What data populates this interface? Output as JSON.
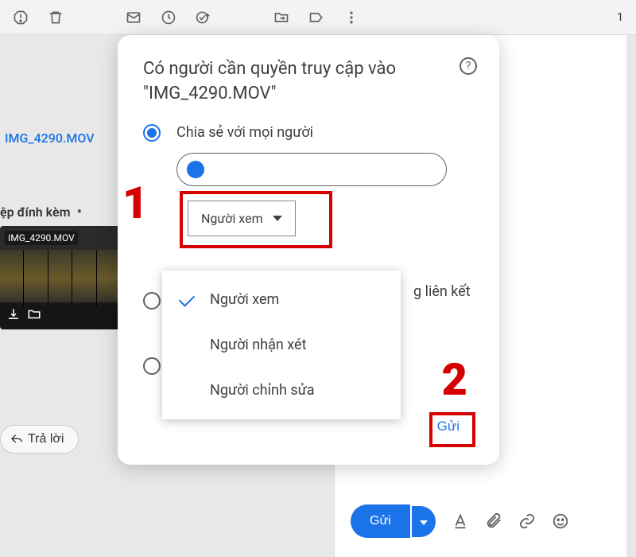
{
  "toolbar": {
    "right_text": "1"
  },
  "background": {
    "file_link": "IMG_4290.MOV",
    "attachment_label": "ệp đính kèm",
    "thumb_label": "IMG_4290.MOV",
    "reply_label": "Trả lời"
  },
  "compose": {
    "send_label": "Gửi"
  },
  "modal": {
    "title": "Có người cần quyền truy cập vào \"IMG_4290.MOV\"",
    "option1_label": "Chia sẻ với mọi người",
    "option2_partial": "g liên kết",
    "permission_selected": "Người xem",
    "dropdown": {
      "viewer": "Người xem",
      "commenter": "Người nhận xét",
      "editor": "Người chỉnh sửa"
    },
    "send_label": "Gửi"
  },
  "annotations": {
    "one": "1",
    "two": "2"
  }
}
